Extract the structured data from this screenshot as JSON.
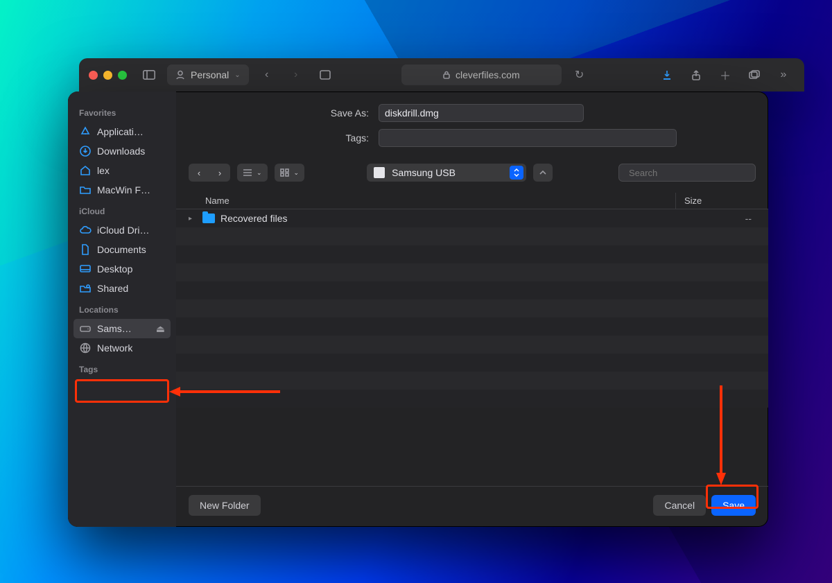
{
  "browser": {
    "profile": "Personal",
    "address": "cleverfiles.com"
  },
  "saveas_label": "Save As:",
  "tags_label": "Tags:",
  "filename": "diskdrill.dmg",
  "location": "Samsung USB",
  "search_placeholder": "Search",
  "columns": {
    "name": "Name",
    "size": "Size"
  },
  "file": {
    "name": "Recovered files",
    "size": "--"
  },
  "buttons": {
    "newfolder": "New Folder",
    "cancel": "Cancel",
    "save": "Save"
  },
  "sidebar": {
    "favorites_head": "Favorites",
    "icloud_head": "iCloud",
    "locations_head": "Locations",
    "tags_head": "Tags",
    "fav": [
      "Applicati…",
      "Downloads",
      "lex",
      "MacWin F…"
    ],
    "icloud": [
      "iCloud Dri…",
      "Documents",
      "Desktop",
      "Shared"
    ],
    "loc": [
      "Sams…",
      "Network"
    ]
  }
}
